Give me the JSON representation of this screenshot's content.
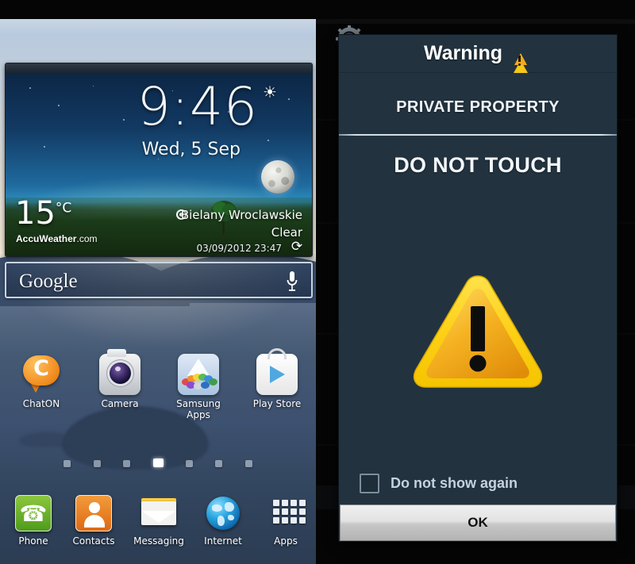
{
  "phone": {
    "widget": {
      "time": "9:46",
      "date": "Wed, 5 Sep",
      "temperature": "15",
      "temperature_unit": "°C",
      "brand": "AccuWeather",
      "brand_suffix": ".com",
      "location": "Bielany Wroclawskie",
      "condition": "Clear",
      "updated": "03/09/2012 23:47",
      "alarm_icon": "alarm-clock-icon",
      "moon_icon": "moon-icon",
      "location_icon": "location-target-icon",
      "refresh_icon": "refresh-icon"
    },
    "search": {
      "label": "Google",
      "mic_icon": "microphone-icon"
    },
    "apps": [
      {
        "label": "ChatON",
        "icon": "chaton-icon"
      },
      {
        "label": "Camera",
        "icon": "camera-icon"
      },
      {
        "label": "Samsung\nApps",
        "icon": "samsung-apps-icon"
      },
      {
        "label": "Play Store",
        "icon": "play-store-icon"
      }
    ],
    "page_indicator": {
      "count": 7,
      "active": 4
    },
    "dock": [
      {
        "label": "Phone",
        "icon": "phone-handset-icon"
      },
      {
        "label": "Contacts",
        "icon": "contacts-person-icon"
      },
      {
        "label": "Messaging",
        "icon": "envelope-icon"
      },
      {
        "label": "Internet",
        "icon": "globe-icon"
      },
      {
        "label": "Apps",
        "icon": "apps-grid-icon"
      }
    ]
  },
  "dialog": {
    "title": "Warning",
    "title_icon": "warning-triangle-icon",
    "line1": "PRIVATE PROPERTY",
    "line2": "DO NOT TOUCH",
    "center_icon": "warning-triangle-large-icon",
    "checkbox_label": "Do not show again",
    "checkbox_checked": false,
    "ok_label": "OK"
  },
  "desktop": {
    "gear_icon": "gear-icon"
  },
  "colors": {
    "dialog_body": "#22333f",
    "dialog_titlebar": "#4b6b86",
    "warning_yellow": "#f6c817",
    "warning_orange": "#e8a118",
    "ok_button": "#dcdcdc"
  }
}
